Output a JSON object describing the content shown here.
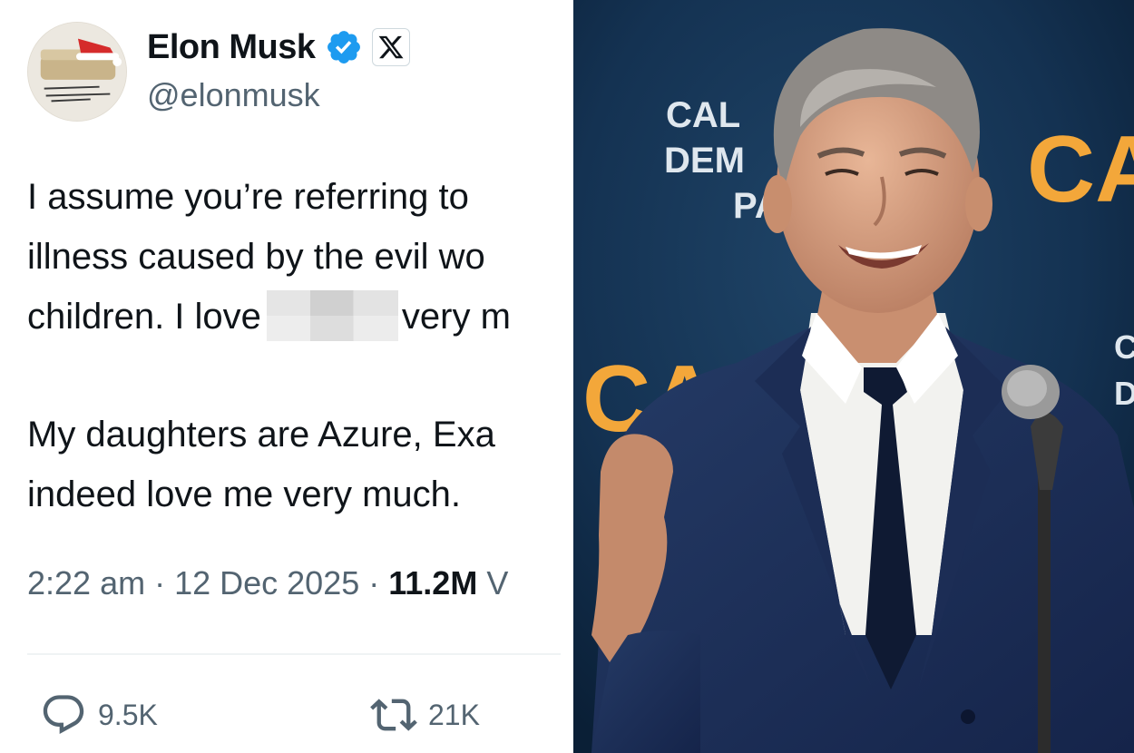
{
  "tweet": {
    "display_name": "Elon Musk",
    "handle": "@elonmusk",
    "text_lines": [
      "I assume you’re referring to",
      "illness caused by the evil wo",
      "children. I love",
      "very m",
      "My daughters are Azure, Exa",
      "indeed love me very much."
    ],
    "meta": {
      "time": "2:22 am",
      "separator": " · ",
      "date": "12 Dec 2025",
      "views": "11.2M",
      "views_suffix": " V"
    },
    "actions": {
      "replies": "9.5K",
      "reposts": "21K"
    },
    "icons": {
      "verified": "verified-badge-icon",
      "affiliate": "x-logo-icon",
      "reply": "reply-icon",
      "repost": "repost-icon"
    },
    "colors": {
      "verified": "#1d9bf0",
      "text": "#0f1419",
      "secondary": "#536471"
    }
  },
  "photo": {
    "backdrop_text": {
      "line1": "CAL",
      "line2": "DEM",
      "line3": "PA",
      "gold_top": "CA",
      "gold_left": "CA",
      "small_right_1": "C",
      "small_right_2": "D"
    },
    "colors": {
      "backdrop": "#0f2a45",
      "suit": "#1d2f55",
      "shirt": "#f3f3f1",
      "tie": "#101a33",
      "gold": "#f3a73a"
    }
  }
}
